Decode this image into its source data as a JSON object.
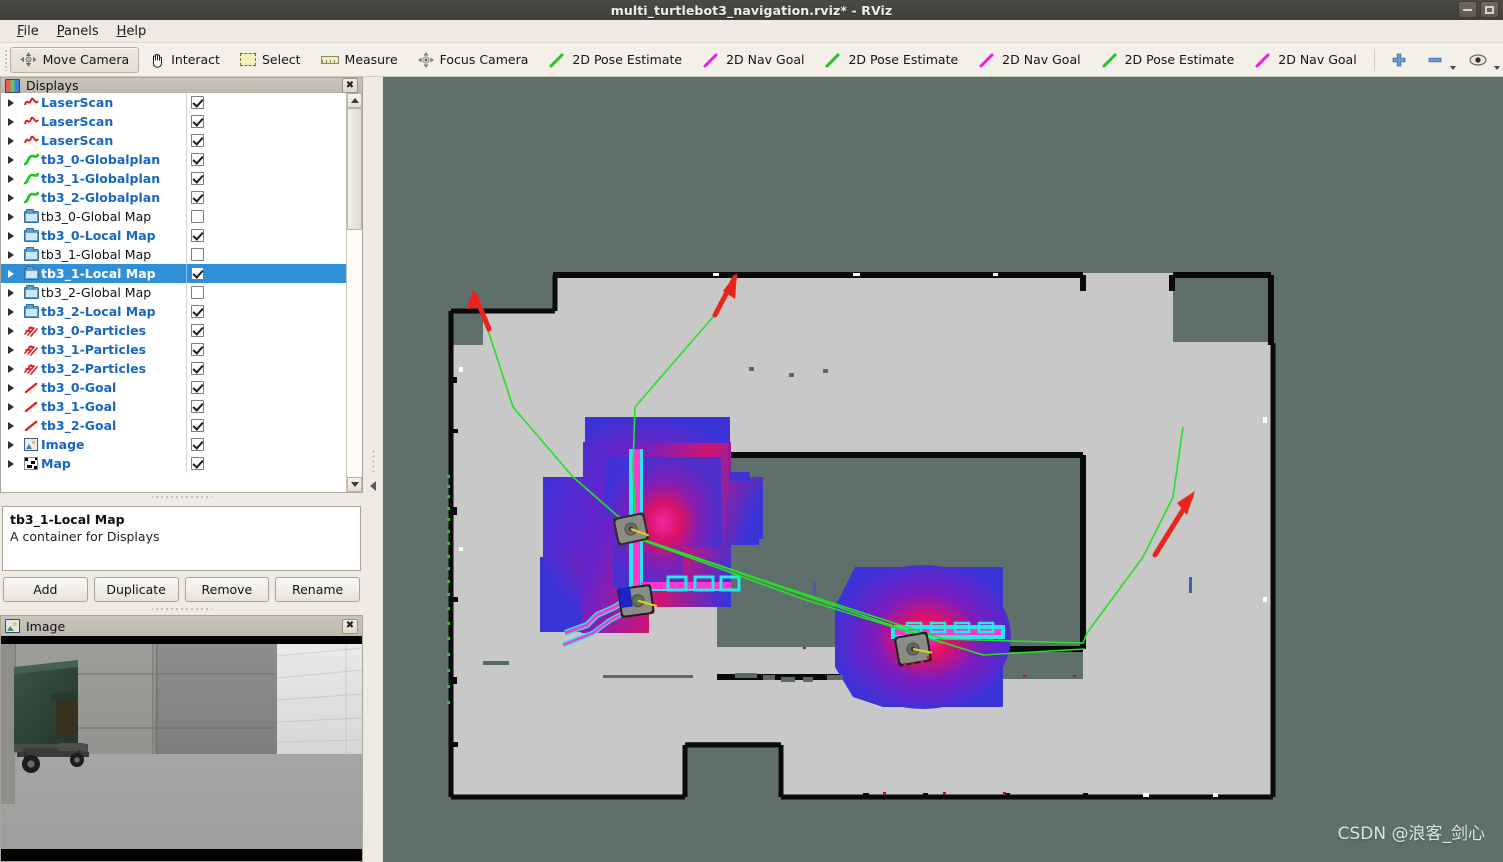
{
  "window": {
    "title": "multi_turtlebot3_navigation.rviz* - RViz",
    "minimize_label": "–",
    "maximize_label": "□"
  },
  "menu": {
    "items": [
      {
        "label": "File",
        "mnemonic": "F"
      },
      {
        "label": "Panels",
        "mnemonic": "P"
      },
      {
        "label": "Help",
        "mnemonic": "H"
      }
    ]
  },
  "toolbar": {
    "items": [
      {
        "label": "Move Camera",
        "icon": "move-camera-icon",
        "active": true
      },
      {
        "label": "Interact",
        "icon": "interact-hand-icon",
        "active": false
      },
      {
        "label": "Select",
        "icon": "select-rect-icon",
        "active": false
      },
      {
        "label": "Measure",
        "icon": "measure-ruler-icon",
        "active": false
      },
      {
        "label": "Focus Camera",
        "icon": "focus-camera-icon",
        "active": false
      },
      {
        "label": "2D Pose Estimate",
        "icon": "pose-estimate-green-arrow-icon",
        "active": false
      },
      {
        "label": "2D Nav Goal",
        "icon": "nav-goal-magenta-arrow-icon",
        "active": false
      },
      {
        "label": "2D Pose Estimate",
        "icon": "pose-estimate-green-arrow-icon",
        "active": false
      },
      {
        "label": "2D Nav Goal",
        "icon": "nav-goal-magenta-arrow-icon",
        "active": false
      },
      {
        "label": "2D Pose Estimate",
        "icon": "pose-estimate-green-arrow-icon",
        "active": false
      },
      {
        "label": "2D Nav Goal",
        "icon": "nav-goal-magenta-arrow-icon",
        "active": false
      }
    ],
    "trailing_icons": [
      "plus-icon",
      "minus-icon",
      "eye-icon"
    ],
    "colors": {
      "pose_estimate_arrow": "#22c422",
      "nav_goal_arrow": "#e420d8",
      "plus_minus": "#4a7fc8"
    }
  },
  "displays_panel": {
    "title": "Displays",
    "icon": "displays-monitor-icon",
    "close_label": "✖",
    "tree": [
      {
        "label": "LaserScan",
        "icon": "laserscan-icon",
        "checked": true,
        "selected": false
      },
      {
        "label": "LaserScan",
        "icon": "laserscan-icon",
        "checked": true,
        "selected": false
      },
      {
        "label": "LaserScan",
        "icon": "laserscan-icon",
        "checked": true,
        "selected": false
      },
      {
        "label": "tb3_0-Globalplan",
        "icon": "path-icon",
        "checked": true,
        "selected": false
      },
      {
        "label": "tb3_1-Globalplan",
        "icon": "path-icon",
        "checked": true,
        "selected": false
      },
      {
        "label": "tb3_2-Globalplan",
        "icon": "path-icon",
        "checked": true,
        "selected": false
      },
      {
        "label": "tb3_0-Global Map",
        "icon": "folder-icon",
        "checked": false,
        "selected": false
      },
      {
        "label": "tb3_0-Local Map",
        "icon": "folder-icon",
        "checked": true,
        "selected": false
      },
      {
        "label": "tb3_1-Global Map",
        "icon": "folder-icon",
        "checked": false,
        "selected": false
      },
      {
        "label": "tb3_1-Local Map",
        "icon": "folder-icon",
        "checked": true,
        "selected": true
      },
      {
        "label": "tb3_2-Global Map",
        "icon": "folder-icon",
        "checked": false,
        "selected": false
      },
      {
        "label": "tb3_2-Local Map",
        "icon": "folder-icon",
        "checked": true,
        "selected": false
      },
      {
        "label": "tb3_0-Particles",
        "icon": "particles-icon",
        "checked": true,
        "selected": false
      },
      {
        "label": "tb3_1-Particles",
        "icon": "particles-icon",
        "checked": true,
        "selected": false
      },
      {
        "label": "tb3_2-Particles",
        "icon": "particles-icon",
        "checked": true,
        "selected": false
      },
      {
        "label": "tb3_0-Goal",
        "icon": "goal-arrow-icon",
        "checked": true,
        "selected": false
      },
      {
        "label": "tb3_1-Goal",
        "icon": "goal-arrow-icon",
        "checked": true,
        "selected": false
      },
      {
        "label": "tb3_2-Goal",
        "icon": "goal-arrow-icon",
        "checked": true,
        "selected": false
      },
      {
        "label": "Image",
        "icon": "image-icon",
        "checked": true,
        "selected": false
      },
      {
        "label": "Map",
        "icon": "map-grid-icon",
        "checked": true,
        "selected": false
      }
    ],
    "colors": {
      "enabled_label": "#1867c0",
      "disabled_label": "#111111",
      "selection": "#2f8fd8"
    }
  },
  "description": {
    "title": "tb3_1-Local Map",
    "text": "A container for Displays"
  },
  "buttons": {
    "add": "Add",
    "duplicate": "Duplicate",
    "remove": "Remove",
    "rename": "Rename"
  },
  "image_panel": {
    "title": "Image",
    "icon": "image-panel-icon",
    "close_label": "✖",
    "scene_description": "Gazebo camera view: dark green dumpster with wheels beside gray concrete walls"
  },
  "viewport": {
    "background_color": "#5f6f6c",
    "grid_color": "#cdd4d2",
    "map_free_color": "#c8c8c8",
    "map_wall_color": "#0a0a0a",
    "costmap_colors": {
      "inflation_low": "#3a3ad8",
      "inflation_high": "#e0105a",
      "lethal": "#ff35d0",
      "obstacle_outline": "#26e8e8"
    },
    "path_color": "#25e025",
    "goal_arrow_color": "#e8241c",
    "particle_color": "#22cc22",
    "robot_count": 3,
    "watermark": "CSDN @浪客_剑心"
  }
}
